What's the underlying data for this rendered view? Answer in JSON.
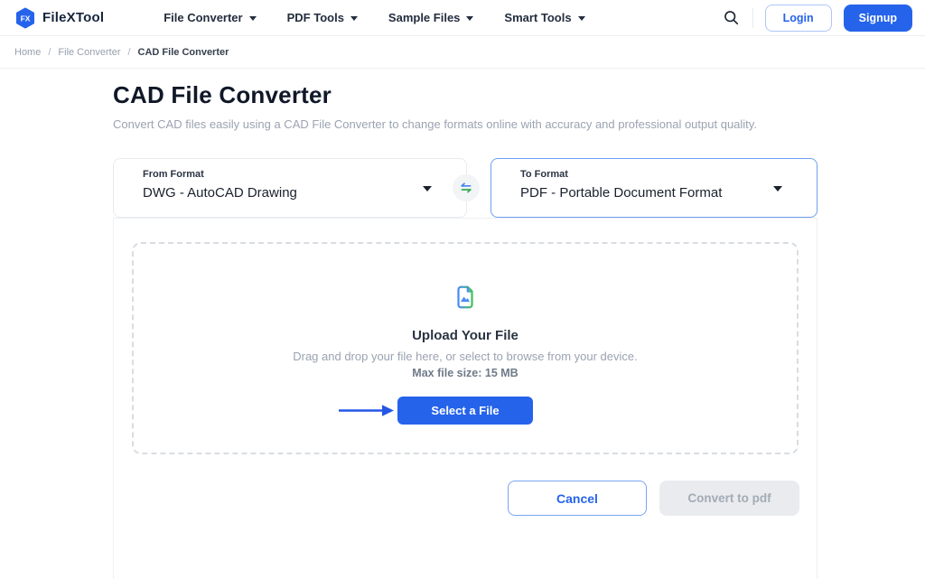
{
  "nav": {
    "logo_monogram": "FX",
    "brand": "FileXTool",
    "items": [
      {
        "label": "File Converter"
      },
      {
        "label": "PDF Tools"
      },
      {
        "label": "Sample Files"
      },
      {
        "label": "Smart Tools"
      }
    ],
    "login_label": "Login",
    "signup_label": "Signup"
  },
  "breadcrumb": {
    "separator": "/",
    "items": [
      "Home",
      "File Converter",
      "CAD File Converter"
    ]
  },
  "page": {
    "title": "CAD File Converter",
    "subtitle": "Convert CAD files easily using a CAD File Converter to change formats online with accuracy and professional output quality."
  },
  "converter": {
    "from_label": "From Format",
    "from_value": "DWG - AutoCAD Drawing",
    "to_label": "To Format",
    "to_value": "PDF - Portable Document Format",
    "swap_icon": "swap-horizontal-icon"
  },
  "upload": {
    "file_icon": "image-file-icon",
    "heading": "Upload Your File",
    "hint": "Drag and drop your file here, or select to browse from your device.",
    "max_size": "Max file size: 15 MB",
    "select_button_label": "Select a File",
    "pointer_icon": "arrow-right-icon"
  },
  "actions": {
    "cancel_label": "Cancel",
    "convert_label": "Convert to pdf"
  },
  "colors": {
    "accent_blue": "#2563eb",
    "to_box_border_blue": "#6f9ff0",
    "swap_green": "#34a853",
    "icon_blue": "#4b8bf5",
    "disabled_bg": "#e9ebee",
    "disabled_text": "#a3abb5"
  }
}
